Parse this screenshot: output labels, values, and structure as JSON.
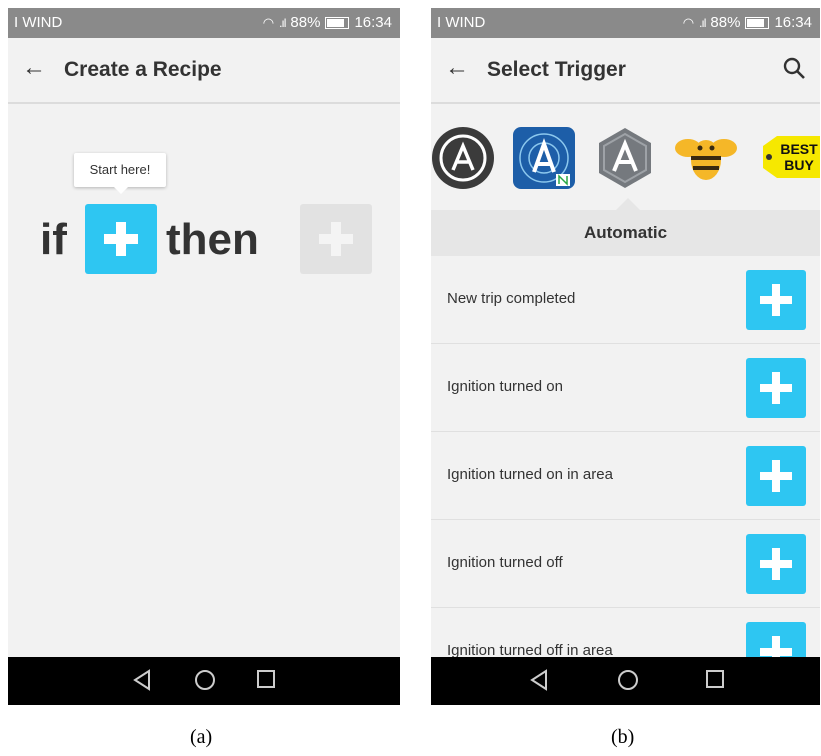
{
  "panel_a": {
    "status": {
      "carrier": "I WIND",
      "battery": "88%",
      "time": "16:34"
    },
    "appbar": {
      "title": "Create a Recipe"
    },
    "tooltip": "Start here!",
    "recipe": {
      "if_word": "if",
      "then_word": "then"
    },
    "caption": "(a)"
  },
  "panel_b": {
    "status": {
      "carrier": "I WIND",
      "battery": "88%",
      "time": "16:34"
    },
    "appbar": {
      "title": "Select Trigger"
    },
    "channel_icons": [
      "automatic-dark-icon",
      "automatic-navigator-icon",
      "automatic-hexagon-icon",
      "bee-icon",
      "best-buy-icon"
    ],
    "best_buy_text": "BEST BUY",
    "section_title": "Automatic",
    "triggers": [
      "New trip completed",
      "Ignition turned on",
      "Ignition turned on in area",
      "Ignition turned off",
      "Ignition turned off in area"
    ],
    "caption": "(b)"
  },
  "colors": {
    "accent": "#2ec6f2",
    "status_bar": "#8a8a8a",
    "background": "#f2f2f2",
    "nav_bar": "#000000"
  }
}
